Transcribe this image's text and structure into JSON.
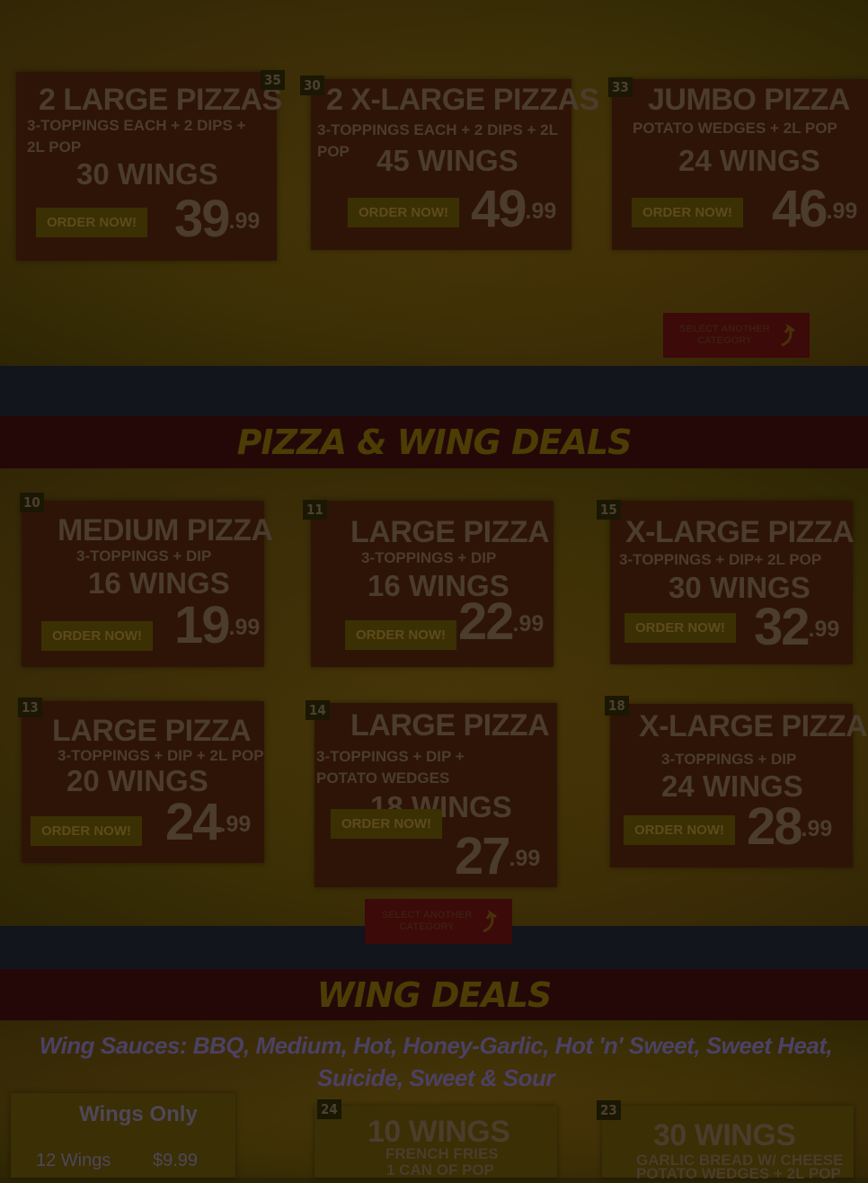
{
  "top_deals": [
    {
      "number": "35",
      "title": "2 LARGE PIZZAS",
      "subtitle": "3-TOPPINGS EACH + 2 DIPS + 2L POP",
      "wings": "30 WINGS",
      "order": "ORDER NOW!",
      "price_main": "39",
      "price_cents": ".99"
    },
    {
      "number": "30",
      "title": "2 X-LARGE PIZZAS",
      "subtitle": "3-TOPPINGS EACH + 2 DIPS + 2L POP",
      "wings": "45 WINGS",
      "order": "ORDER NOW!",
      "price_main": "49",
      "price_cents": ".99"
    },
    {
      "number": "33",
      "title": "JUMBO PIZZA",
      "subtitle": "POTATO WEDGES + 2L POP",
      "wings": "24 WINGS",
      "order": "ORDER NOW!",
      "price_main": "46",
      "price_cents": ".99"
    }
  ],
  "select_another_label": "SELECT ANOTHER CATEGORY",
  "pizza_wing_section": {
    "heading": "PIZZA & WING DEALS",
    "deals": [
      {
        "number": "10",
        "title": "MEDIUM PIZZA",
        "subtitle": "3-TOPPINGS + DIP",
        "wings": "16 WINGS",
        "order": "ORDER NOW!",
        "price_main": "19",
        "price_cents": ".99"
      },
      {
        "number": "11",
        "title": "LARGE PIZZA",
        "subtitle": "3-TOPPINGS + DIP",
        "wings": "16 WINGS",
        "order": "ORDER NOW!",
        "price_main": "22",
        "price_cents": ".99"
      },
      {
        "number": "15",
        "title": "X-LARGE PIZZA",
        "subtitle": "3-TOPPINGS + DIP+ 2L POP",
        "wings": "30 WINGS",
        "order": "ORDER NOW!",
        "price_main": "32",
        "price_cents": ".99"
      },
      {
        "number": "13",
        "title": "LARGE PIZZA",
        "subtitle": "3-TOPPINGS + DIP + 2L POP",
        "wings": "20 WINGS",
        "order": "ORDER NOW!",
        "price_main": "24",
        "price_cents": ".99"
      },
      {
        "number": "14",
        "title": "LARGE PIZZA",
        "subtitle": "3-TOPPINGS + DIP + POTATO WEDGES",
        "wings": "18 WINGS",
        "order": "ORDER NOW!",
        "price_main": "27",
        "price_cents": ".99"
      },
      {
        "number": "18",
        "title": "X-LARGE PIZZA",
        "subtitle": "3-TOPPINGS + DIP",
        "wings": "24 WINGS",
        "order": "ORDER NOW!",
        "price_main": "28",
        "price_cents": ".99"
      }
    ]
  },
  "wing_section": {
    "heading": "WING DEALS",
    "sauces": "Wing Sauces: BBQ, Medium, Hot, Honey-Garlic, Hot 'n' Sweet, Sweet Heat, Suicide, Sweet & Sour",
    "wings_only": {
      "title": "Wings Only",
      "rows": [
        {
          "qty": "12 Wings",
          "price": "$9.99"
        }
      ]
    },
    "deals": [
      {
        "number": "24",
        "title": "10 WINGS",
        "line1": "FRENCH FRIES",
        "line2": "1 CAN OF POP"
      },
      {
        "number": "23",
        "title": "30 WINGS",
        "line1": "GARLIC BREAD W/ CHEESE",
        "line2": "POTATO WEDGES + 2L POP"
      }
    ]
  }
}
